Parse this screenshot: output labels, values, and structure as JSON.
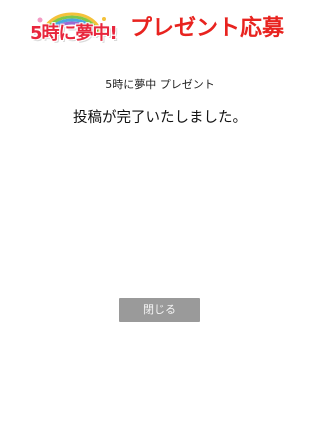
{
  "header": {
    "logo_text": "5時に夢中!",
    "title": "プレゼント応募"
  },
  "main": {
    "subtitle": "5時に夢中 プレゼント",
    "message": "投稿が完了いたしました。",
    "close_label": "閉じる"
  },
  "colors": {
    "title_red": "#e8231f",
    "button_gray": "#9a9a9a"
  }
}
